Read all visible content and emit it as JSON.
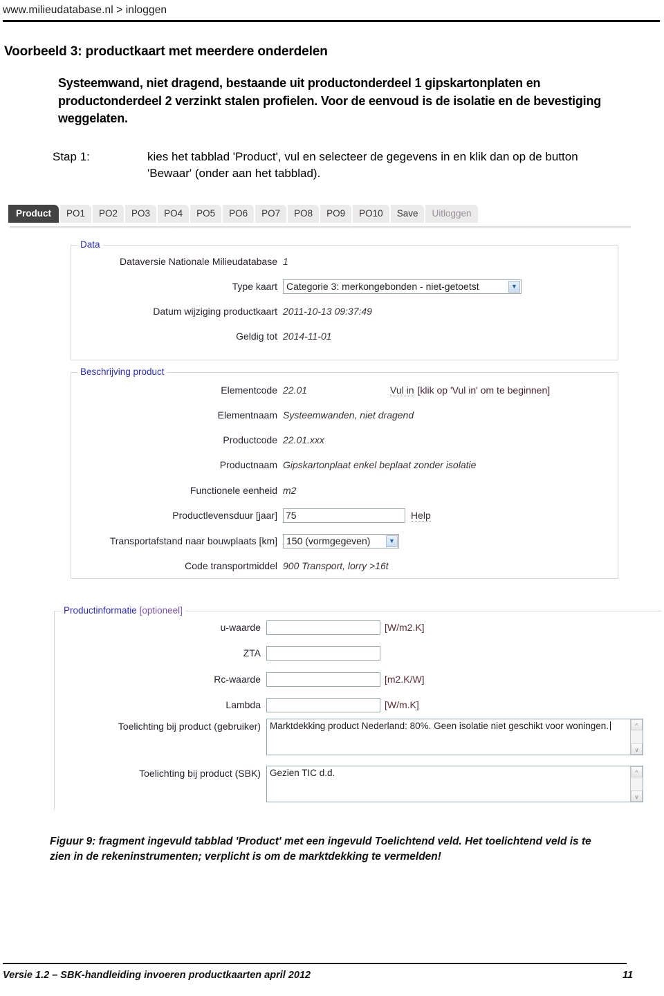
{
  "header": {
    "breadcrumb": "www.milieudatabase.nl > inloggen"
  },
  "doc": {
    "heading": "Voorbeeld 3: productkaart met meerdere onderdelen",
    "lead": "Systeemwand, niet dragend, bestaande uit productonderdeel 1 gipskartonplaten en productonderdeel 2 verzinkt stalen profielen. Voor de eenvoud is de isolatie en de bevestiging weggelaten.",
    "step_label": "Stap 1:",
    "step_text": "kies het tabblad 'Product', vul en selecteer de gegevens in en klik dan op de button 'Bewaar' (onder aan het tabblad).",
    "caption": "Figuur 9: fragment ingevuld  tabblad 'Product' met een ingevuld Toelichtend veld.  Het  toelichtend veld is te zien in de rekeninstrumenten; verplicht is om de marktdekking te vermelden!"
  },
  "app": {
    "tabs": [
      {
        "label": "Product",
        "state": "active"
      },
      {
        "label": "PO1",
        "state": "normal"
      },
      {
        "label": "PO2",
        "state": "normal"
      },
      {
        "label": "PO3",
        "state": "normal"
      },
      {
        "label": "PO4",
        "state": "normal"
      },
      {
        "label": "PO5",
        "state": "normal"
      },
      {
        "label": "PO6",
        "state": "normal"
      },
      {
        "label": "PO7",
        "state": "normal"
      },
      {
        "label": "PO8",
        "state": "normal"
      },
      {
        "label": "PO9",
        "state": "normal"
      },
      {
        "label": "PO10",
        "state": "normal"
      },
      {
        "label": "Save",
        "state": "normal"
      },
      {
        "label": "Uitloggen",
        "state": "muted"
      }
    ],
    "data_section": {
      "legend": "Data",
      "rows": [
        {
          "label": "Dataversie Nationale Milieudatabase",
          "value": "1"
        },
        {
          "label": "Type kaart",
          "value": "Categorie 3: merkongebonden - niet-getoetst"
        },
        {
          "label": "Datum wijziging productkaart",
          "value": "2011-10-13 09:37:49"
        },
        {
          "label": "Geldig tot",
          "value": "2014-11-01"
        }
      ]
    },
    "description_section": {
      "legend": "Beschrijving product",
      "elementcode_label": "Elementcode",
      "elementcode_value": "22.01",
      "fill_link": "Vul in",
      "fill_hint": "[klik op 'Vul in' om te beginnen]",
      "elementnaam_label": "Elementnaam",
      "elementnaam_value": "Systeemwanden, niet dragend",
      "productcode_label": "Productcode",
      "productcode_value": "22.01.xxx",
      "productnaam_label": "Productnaam",
      "productnaam_value": "Gipskartonplaat enkel beplaat zonder isolatie",
      "eenheid_label": "Functionele eenheid",
      "eenheid_value": "m2",
      "levensduur_label": "Productlevensduur [jaar]",
      "levensduur_value": "75",
      "help_link": "Help",
      "transport_label": "Transportafstand naar bouwplaats [km]",
      "transport_value": "150 (vormgegeven)",
      "transportmiddel_label": "Code transportmiddel",
      "transportmiddel_value": "900 Transport, lorry >16t"
    },
    "product_info_section": {
      "legend_main": "Productinformatie",
      "legend_optional": " [optioneel]",
      "fields": [
        {
          "label": "u-waarde",
          "value": "",
          "unit": "[W/m2.K]"
        },
        {
          "label": "ZTA",
          "value": "",
          "unit": ""
        },
        {
          "label": "Rc-waarde",
          "value": "",
          "unit": "[m2.K/W]"
        },
        {
          "label": "Lambda",
          "value": "",
          "unit": "[W/m.K]"
        }
      ],
      "toelichting_user_label": "Toelichting bij product (gebruiker)",
      "toelichting_user_value": "Marktdekking product Nederland: 80%. Geen isolatie niet geschikt voor woningen.",
      "toelichting_sbk_label": "Toelichting bij product (SBK)",
      "toelichting_sbk_value": "Gezien TIC d.d."
    },
    "icons": {
      "dropdown": "▼",
      "scroll_up": "^",
      "scroll_down": "∨"
    }
  },
  "footer": {
    "left": "Versie 1.2 – SBK-handleiding invoeren productkaarten april 2012",
    "page": "11"
  }
}
